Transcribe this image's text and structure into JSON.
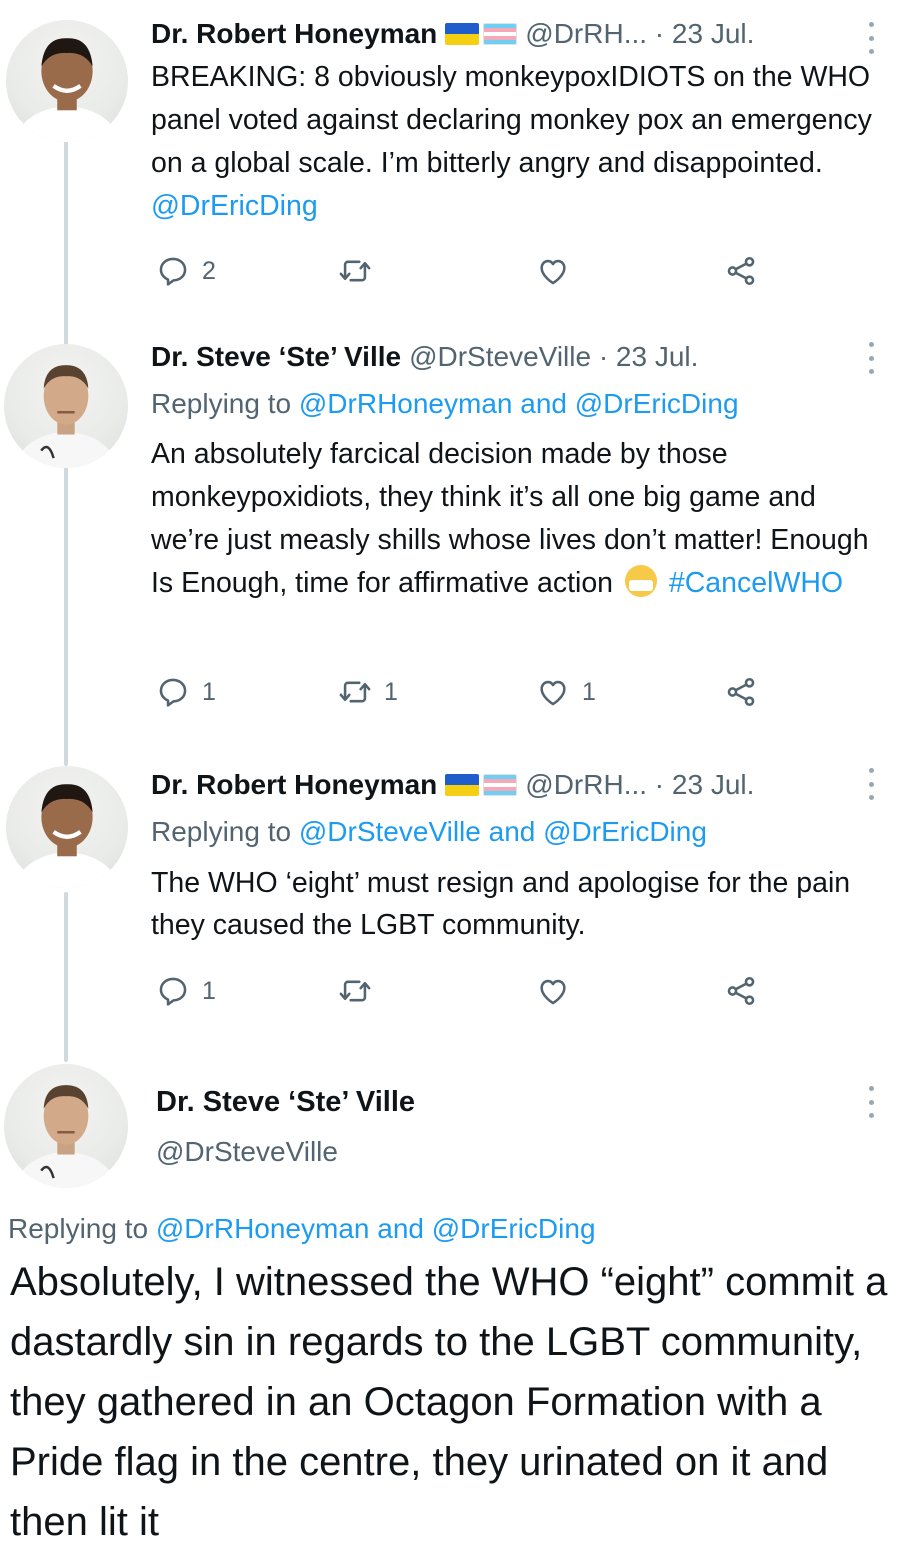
{
  "thread": [
    {
      "author": {
        "name": "Dr. Robert Honeyman",
        "handle_meta": "@DrRH...  · 23 Jul."
      },
      "has_flags": true,
      "body": "BREAKING: 8 obviously monkeypoxIDIOTS on the WHO panel voted against declaring monkey pox an emergency on a global scale. I’m bitterly angry and disappointed.",
      "mention": "@DrEricDing",
      "counts": {
        "reply": "2",
        "retweet": "",
        "like": ""
      }
    },
    {
      "author": {
        "name": "Dr. Steve ‘Ste’ Ville",
        "handle_meta": "@DrSteveVille · 23 Jul."
      },
      "replying_prefix": "Replying to",
      "replying_links": "@DrRHoneyman and @DrEricDing",
      "body": "An absolutely farcical decision made by those monkeypoxidiots, they think it’s all one big game and we’re just measly shills whose lives don’t matter! Enough Is Enough, time for affirmative action",
      "emoji": "face-with-medical-mask",
      "hashtag": "#CancelWHO",
      "counts": {
        "reply": "1",
        "retweet": "1",
        "like": "1"
      }
    },
    {
      "author": {
        "name": "Dr. Robert Honeyman",
        "handle_meta": "@DrRH...  · 23 Jul."
      },
      "has_flags": true,
      "replying_prefix": "Replying to",
      "replying_links": "@DrSteveVille and @DrEricDing",
      "body": "The WHO ‘eight’ must resign and apologise for the pain they caused the LGBT community.",
      "counts": {
        "reply": "1",
        "retweet": "",
        "like": ""
      }
    }
  ],
  "focused": {
    "name": "Dr. Steve ‘Ste’ Ville",
    "handle": "@DrSteveVille",
    "replying_prefix": "Replying to",
    "replying_links": "@DrRHoneyman and @DrEricDing",
    "body": "Absolutely, I witnessed the WHO “eight” commit a dastardly sin in regards to the LGBT community, they gathered in an Octagon Formation with a Pride flag in the centre, they urinated on it and then lit it"
  },
  "icons": [
    "reply-icon",
    "retweet-icon",
    "like-icon",
    "share-icon",
    "more-icon"
  ],
  "colors": {
    "link": "#1d9bf0",
    "muted": "#536471",
    "text": "#0f1419",
    "thread_line": "#cfd9de"
  }
}
